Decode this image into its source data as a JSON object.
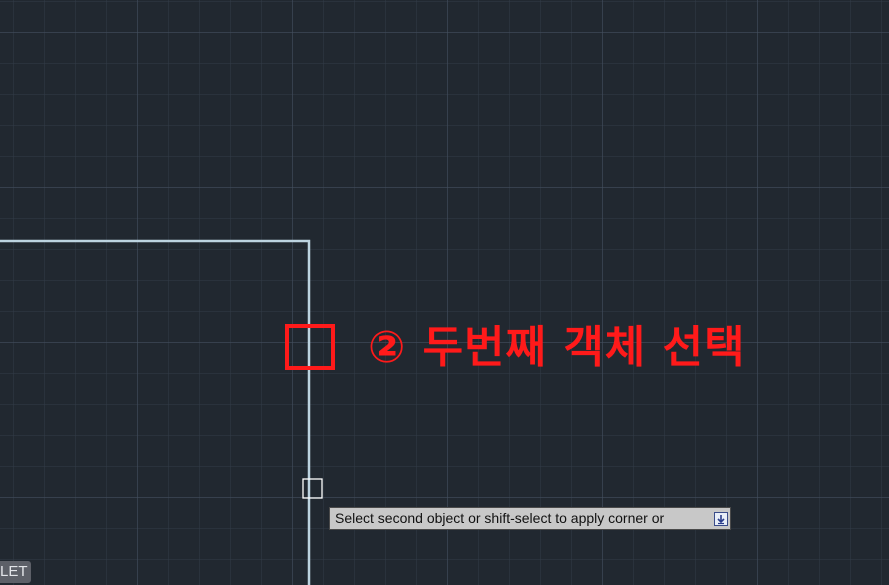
{
  "annotation": {
    "text": "② 두번째 객체 선택",
    "color": "#ff1a1a"
  },
  "tooltip": {
    "text": "Select second object or shift-select to apply corner or",
    "expand_icon": "expand-down-arrow-icon"
  },
  "command_badge": {
    "text": "LET"
  },
  "colors": {
    "background": "#212830",
    "line": "#bcd3e0",
    "highlight": "#ff1a1a",
    "pickbox": "#ffffff"
  }
}
